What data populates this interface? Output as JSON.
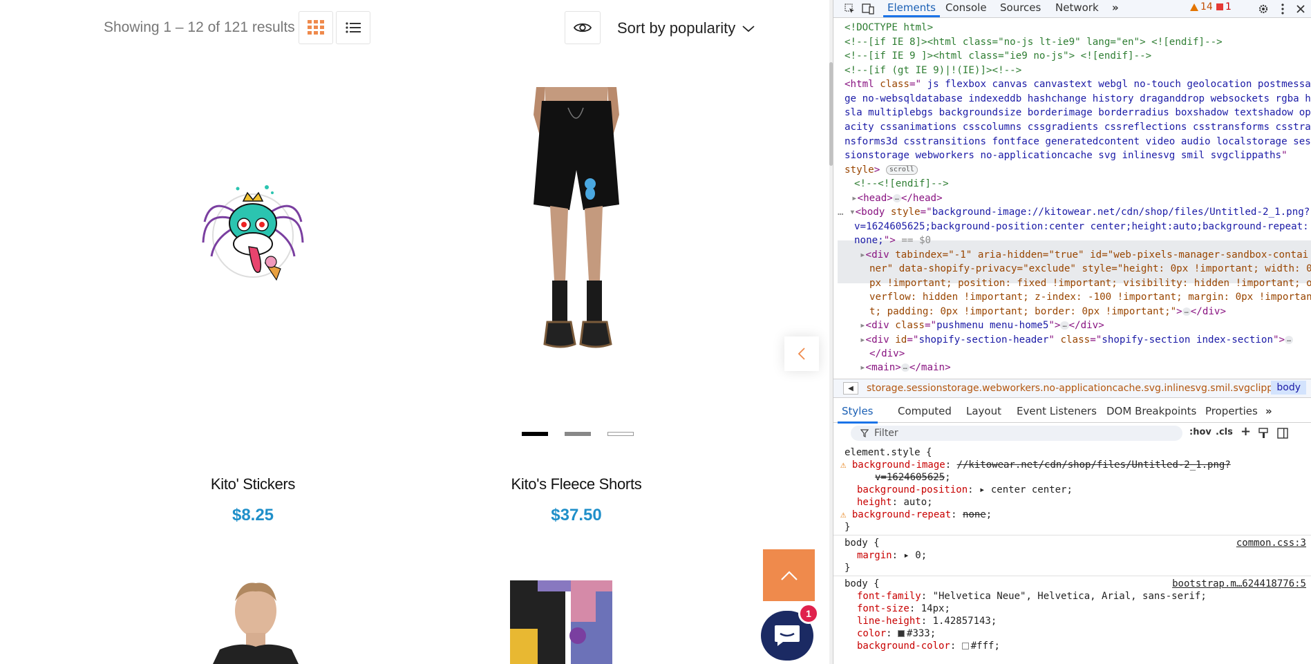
{
  "toolbar": {
    "results_text": "Showing 1 – 12 of 121 results",
    "sort_label": "Sort by popularity"
  },
  "products": [
    {
      "title": "Kito' Stickers",
      "price": "$8.25"
    },
    {
      "title": "Kito's Fleece Shorts",
      "price": "$37.50"
    }
  ],
  "chat": {
    "badge_count": "1"
  },
  "colors": {
    "accent": "#ef8a4c",
    "price": "#1f8fc9",
    "chat": "#1b2a63",
    "badge": "#e0224d"
  },
  "devtools": {
    "tabs": [
      "Elements",
      "Console",
      "Sources",
      "Network"
    ],
    "warnings": "14",
    "errors": "1",
    "dom_lines": [
      "<!DOCTYPE html>",
      "<!--[if IE 8]><html class=\"no-js lt-ie9\" lang=\"en\"> <![endif]-->",
      "<!--[if IE 9 ]><html class=\"ie9 no-js\"> <![endif]-->",
      "<!--[if (gt IE 9)|!(IE)]><!-->"
    ],
    "html_class_lines": [
      " js flexbox canvas canvastext webgl no-touch geolocation postmessa",
      "ge no-websqldatabase indexeddb hashchange history draganddrop websockets rgba h",
      "sla multiplebgs backgroundsize borderimage borderradius boxshadow textshadow op",
      "acity cssanimations csscolumns cssgradients cssreflections csstransforms csstra",
      "nsforms3d csstransitions fontface generatedcontent video audio localstorage ses",
      "sionstorage webworkers no-applicationcache svg inlinesvg smil svgclippaths"
    ],
    "scroll_pill": "scroll",
    "endif_comment": "<!--<![endif]-->",
    "body_style_lines": [
      "background-image://kitowear.net/cdn/shop/files/Untitled-2_1.png?",
      "v=1624605625;background-position:center center;height:auto;background-repeat:",
      "none;"
    ],
    "dollar0": "== $0",
    "div_lines": [
      "tabindex=\"-1\" aria-hidden=\"true\" id=\"web-pixels-manager-sandbox-contai",
      "ner\" data-shopify-privacy=\"exclude\" style=\"height: 0px !important; width: 0",
      "px !important; position: fixed !important; visibility: hidden !important; o",
      "verflow: hidden !important; z-index: -100 !important; margin: 0px !importan",
      "t; padding: 0px !important; border: 0px !important;\""
    ],
    "pushmenu_class": "pushmenu menu-home5",
    "header_id": "shopify-section-header",
    "header_class": "shopify-section index-section",
    "breadcrumb_path": "storage.sessionstorage.webworkers.no-applicationcache.svg.inlinesvg.smil.svgclippaths",
    "breadcrumb_body": "body",
    "sub_tabs": [
      "Styles",
      "Computed",
      "Layout",
      "Event Listeners",
      "DOM Breakpoints",
      "Properties"
    ],
    "filter_placeholder": "Filter",
    "hov": ":hov",
    "cls": ".cls",
    "element_style_selector": "element.style {",
    "es_bg_image_value": "//kitowear.net/cdn/shop/files/Untitled-2_1.png?",
    "es_bg_image_value2": "v=1624605625",
    "es_bg_position": "center center",
    "es_height": "auto",
    "es_bg_repeat": "none",
    "rule2_source": "common.css:3",
    "rule2_margin": "0",
    "rule3_source": "bootstrap.m…624418776:5",
    "rule3_font_family": "\"Helvetica Neue\", Helvetica, Arial, sans-serif",
    "rule3_font_size": "14px",
    "rule3_line_height": "1.42857143",
    "rule3_color": "#333",
    "rule3_bg_color": "#fff"
  }
}
